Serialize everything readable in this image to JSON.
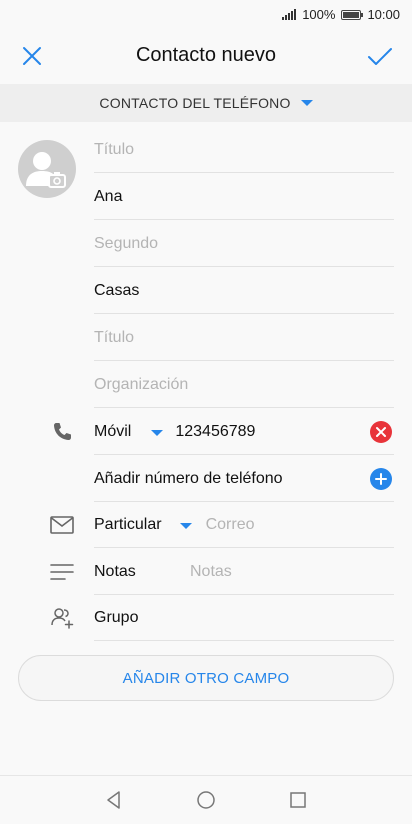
{
  "status": {
    "battery": "100%",
    "time": "10:00"
  },
  "header": {
    "title": "Contacto nuevo"
  },
  "account": {
    "label": "CONTACTO DEL TELÉFONO"
  },
  "form": {
    "title_prefix_placeholder": "Título",
    "first_name": "Ana",
    "middle_name_placeholder": "Segundo",
    "last_name": "Casas",
    "title_suffix_placeholder": "Título",
    "organization_placeholder": "Organización",
    "phone_type": "Móvil",
    "phone_value": "123456789",
    "add_phone_label": "Añadir número de teléfono",
    "email_type": "Particular",
    "email_placeholder": "Correo",
    "notes_label": "Notas",
    "notes_placeholder": "Notas",
    "group_label": "Grupo"
  },
  "add_field_button": "AÑADIR OTRO CAMPO",
  "colors": {
    "accent": "#2686ea",
    "delete": "#e8343a"
  }
}
